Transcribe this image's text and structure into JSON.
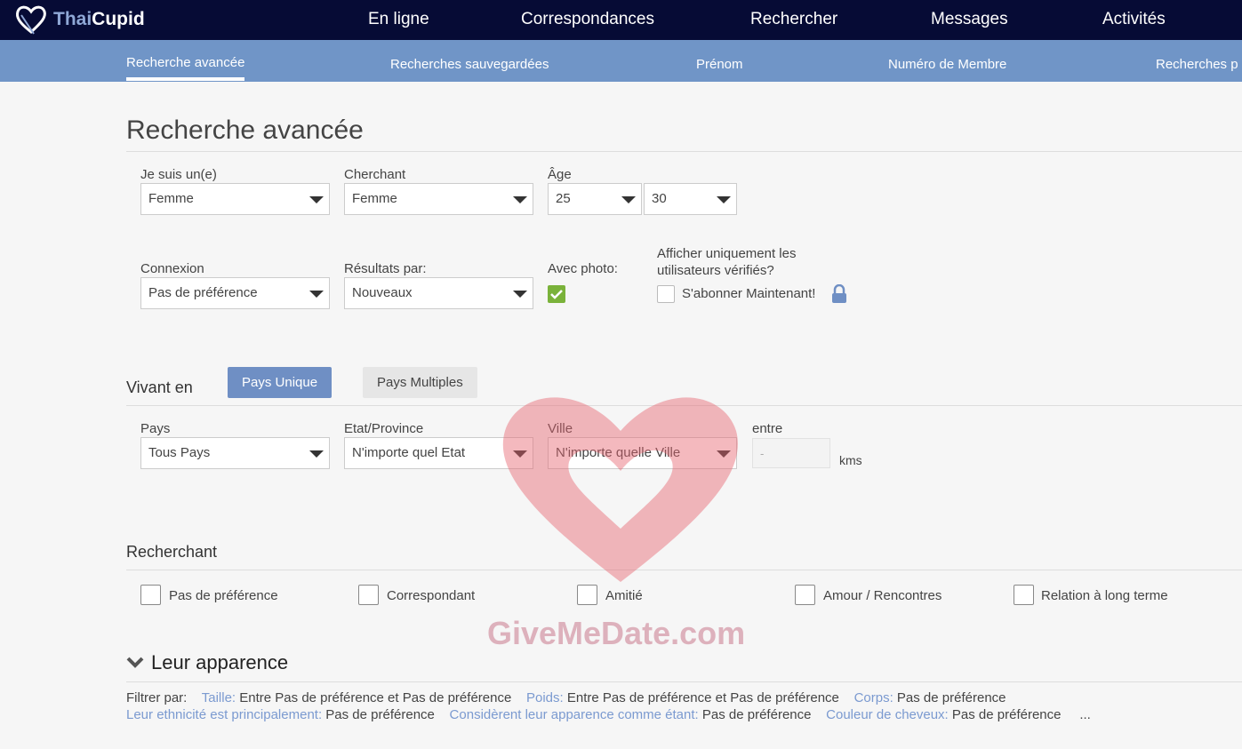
{
  "header": {
    "brand_a": "Thai",
    "brand_b": "Cupid",
    "nav": [
      "En ligne",
      "Correspondances",
      "Rechercher",
      "Messages",
      "Activités"
    ]
  },
  "subnav": [
    "Recherche avancée",
    "Recherches sauvegardées",
    "Prénom",
    "Numéro de Membre",
    "Recherches p"
  ],
  "page_title": "Recherche avancée",
  "form": {
    "iam": {
      "label": "Je suis un(e)",
      "value": "Femme"
    },
    "seeking": {
      "label": "Cherchant",
      "value": "Femme"
    },
    "age": {
      "label": "Âge",
      "min": "25",
      "max": "30"
    },
    "connexion": {
      "label": "Connexion",
      "value": "Pas de préférence"
    },
    "results": {
      "label": "Résultats par:",
      "value": "Nouveaux"
    },
    "photo": {
      "label": "Avec photo:",
      "checked": true
    },
    "verified": {
      "label1": "Afficher uniquement les",
      "label2": "utilisateurs vérifiés?",
      "cb_label": "S'abonner Maintenant!",
      "checked": false
    }
  },
  "living": {
    "title": "Vivant en",
    "btn_single": "Pays Unique",
    "btn_multi": "Pays Multiples",
    "country": {
      "label": "Pays",
      "value": "Tous Pays"
    },
    "state": {
      "label": "Etat/Province",
      "value": "N'importe quel Etat"
    },
    "city": {
      "label": "Ville",
      "value": "N'importe quelle Ville"
    },
    "distance": {
      "label": "entre",
      "placeholder": "-",
      "unit": "kms"
    }
  },
  "seeking_section": {
    "title": "Recherchant",
    "options": [
      "Pas de préférence",
      "Correspondant",
      "Amitié",
      "Amour / Rencontres",
      "Relation à long terme"
    ]
  },
  "appearance": {
    "title": "Leur apparence",
    "filter_label": "Filtrer par:",
    "row1": [
      {
        "k": "Taille:",
        "v": "Entre Pas de préférence et Pas de préférence"
      },
      {
        "k": "Poids:",
        "v": "Entre Pas de préférence et Pas de préférence"
      },
      {
        "k": "Corps:",
        "v": "Pas de préférence"
      }
    ],
    "row2": [
      {
        "k": "Leur ethnicité est principalement:",
        "v": "Pas de préférence"
      },
      {
        "k": "Considèrent leur apparence comme étant:",
        "v": "Pas de préférence"
      },
      {
        "k": "Couleur de cheveux:",
        "v": "Pas de préférence"
      }
    ],
    "more": "..."
  },
  "watermark": "GiveMeDate.com",
  "colors": {
    "header": "#060b35",
    "subnav": "#7095c7",
    "accent": "#6f8fc4",
    "check": "#7ab23a"
  }
}
